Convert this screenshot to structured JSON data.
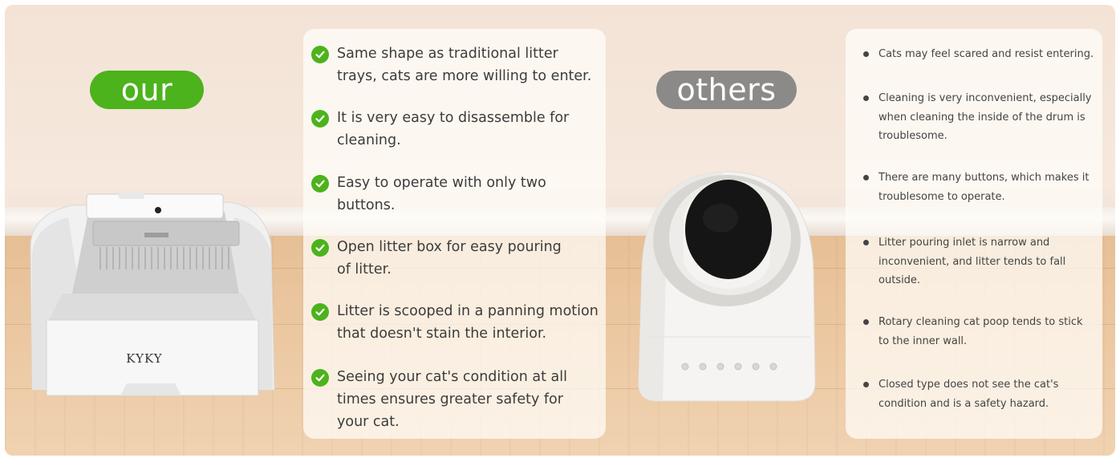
{
  "labels": {
    "ours": "our",
    "others": "others"
  },
  "product_brand": "KYKY",
  "our_features": [
    "Same shape as traditional litter trays, cats are more willing to enter.",
    "It is very easy to disassemble for cleaning.",
    "Easy to operate with only two buttons.",
    "Open litter box for easy pouring of litter.",
    "Litter is scooped in a panning motion that doesn't stain the interior.",
    "Seeing your cat's condition at all times ensures greater safety for your cat."
  ],
  "other_drawbacks": [
    "Cats may feel scared and resist entering.",
    "Cleaning is very inconvenient, especially when cleaning the inside of the drum is troublesome.",
    "There are many buttons, which makes it troublesome to operate.",
    "Litter pouring inlet is narrow and inconvenient, and litter tends to fall outside.",
    "Rotary cleaning cat poop tends to stick to the inner wall.",
    "Closed type does not see the cat's condition and is a safety hazard."
  ],
  "colors": {
    "ours_accent": "#4cb31c",
    "others_accent": "#8b8a89"
  },
  "icons": {
    "feature_marker": "check-circle-icon",
    "drawback_marker": "bullet-dot-icon"
  }
}
